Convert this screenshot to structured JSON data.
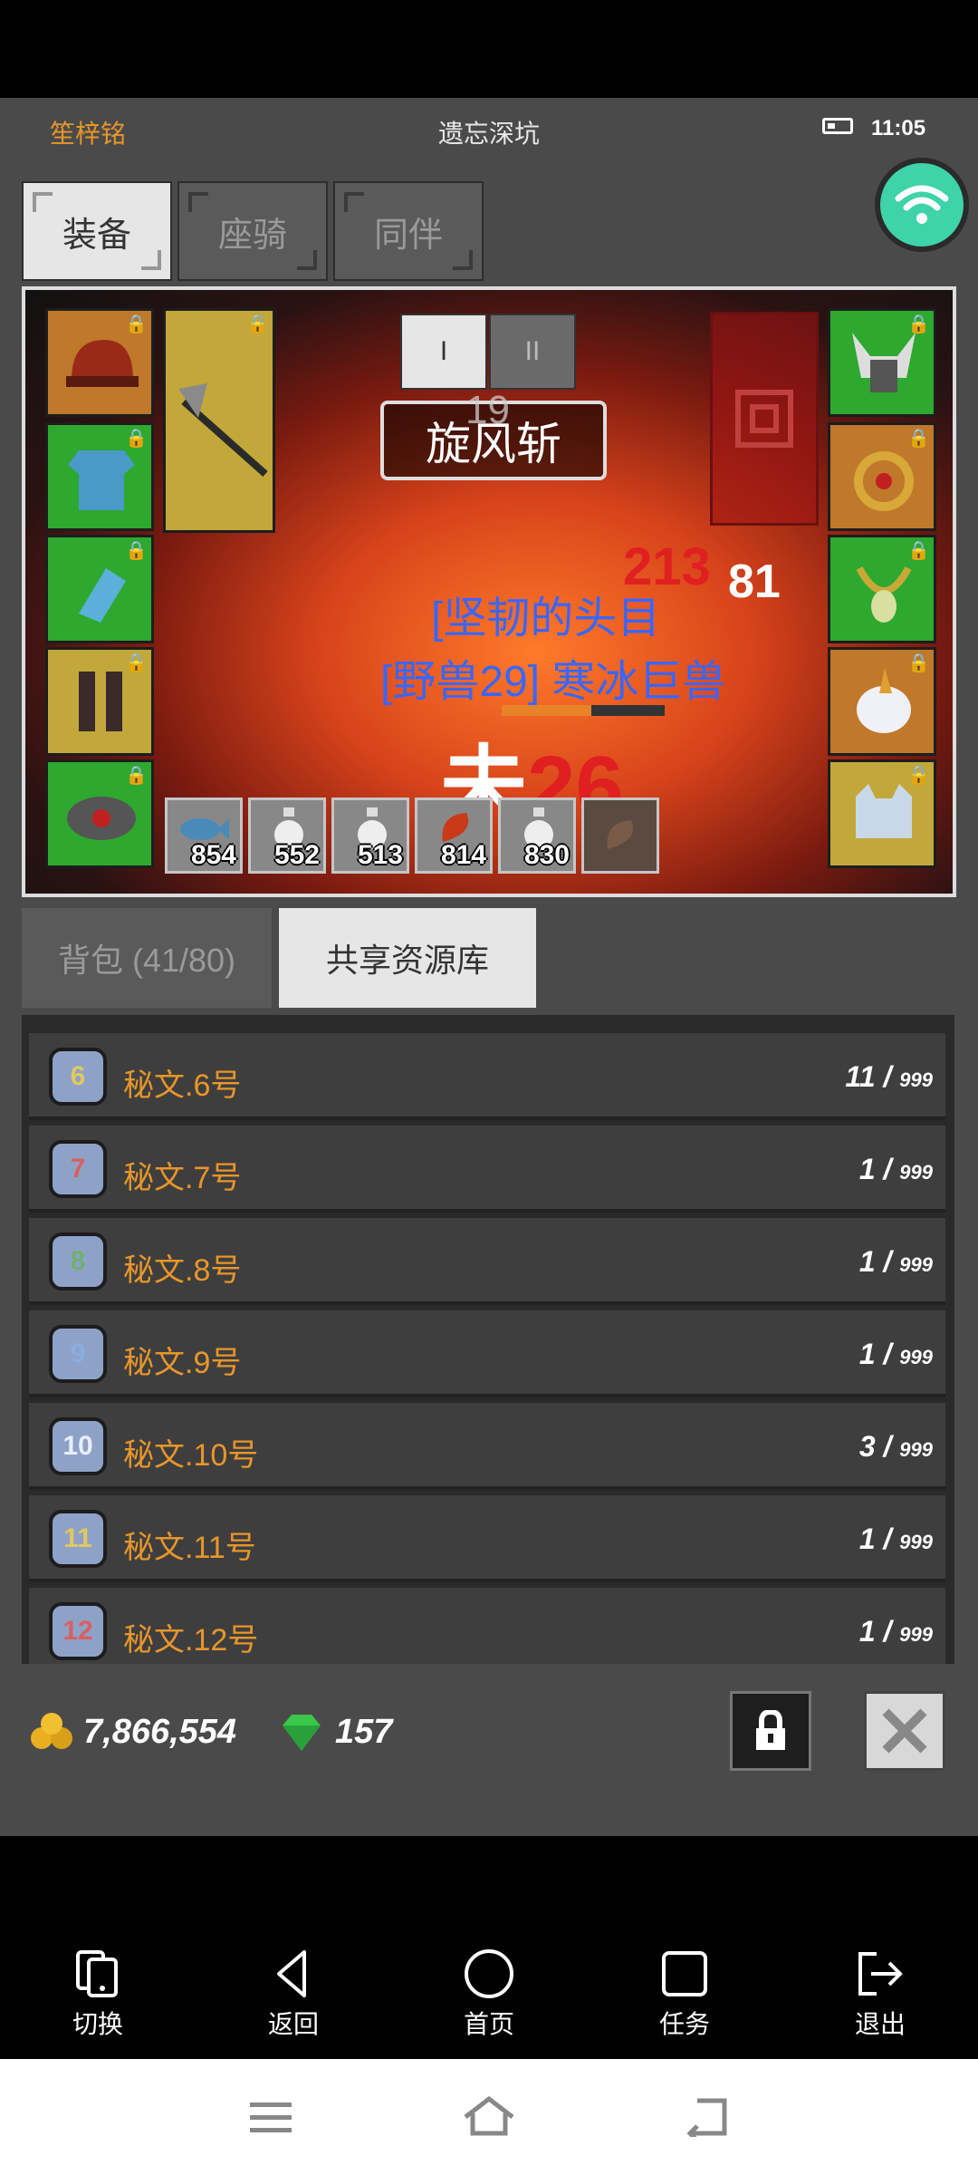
{
  "header": {
    "player_name": "笙梓铭",
    "location": "遗忘深坑",
    "time": "11:05"
  },
  "equip_tabs": [
    {
      "label": "装备"
    },
    {
      "label": "座骑"
    },
    {
      "label": "同伴"
    }
  ],
  "scene": {
    "page_buttons": [
      "I",
      "II"
    ],
    "skill_name": "旋风斩",
    "skill_level": "19",
    "damage_red": "213",
    "damage_white": "81",
    "target_text": "[坚韧的头目",
    "monster_text": "[野兽29] 寒冰巨兽",
    "status_text": "未",
    "status_num": "26",
    "quick_items": [
      {
        "name": "fish-icon",
        "qty": "854"
      },
      {
        "name": "potion-icon",
        "qty": "552"
      },
      {
        "name": "potion-icon",
        "qty": "513"
      },
      {
        "name": "meat-icon",
        "qty": "814"
      },
      {
        "name": "potion-icon",
        "qty": "830"
      }
    ]
  },
  "inventory_tabs": [
    {
      "label": "背包 (41/80)"
    },
    {
      "label": "共享资源库"
    }
  ],
  "items": [
    {
      "name": "秘文.6号",
      "badge": "6",
      "count": "11 /",
      "max": "999"
    },
    {
      "name": "秘文.7号",
      "badge": "7",
      "count": "1 /",
      "max": "999"
    },
    {
      "name": "秘文.8号",
      "badge": "8",
      "count": "1 /",
      "max": "999"
    },
    {
      "name": "秘文.9号",
      "badge": "9",
      "count": "1 /",
      "max": "999"
    },
    {
      "name": "秘文.10号",
      "badge": "10",
      "count": "3 /",
      "max": "999"
    },
    {
      "name": "秘文.11号",
      "badge": "11",
      "count": "1 /",
      "max": "999"
    },
    {
      "name": "秘文.12号",
      "badge": "12",
      "count": "1 /",
      "max": "999"
    }
  ],
  "currency": {
    "gold": "7,866,554",
    "gems": "157"
  },
  "nav": [
    {
      "label": "切换"
    },
    {
      "label": "返回"
    },
    {
      "label": "首页"
    },
    {
      "label": "任务"
    },
    {
      "label": "退出"
    }
  ],
  "colors": {
    "accent_orange": "#e8962a",
    "slot_green": "#2ea82e",
    "slot_orange": "#c0782a",
    "wifi": "#3ed3a8"
  }
}
